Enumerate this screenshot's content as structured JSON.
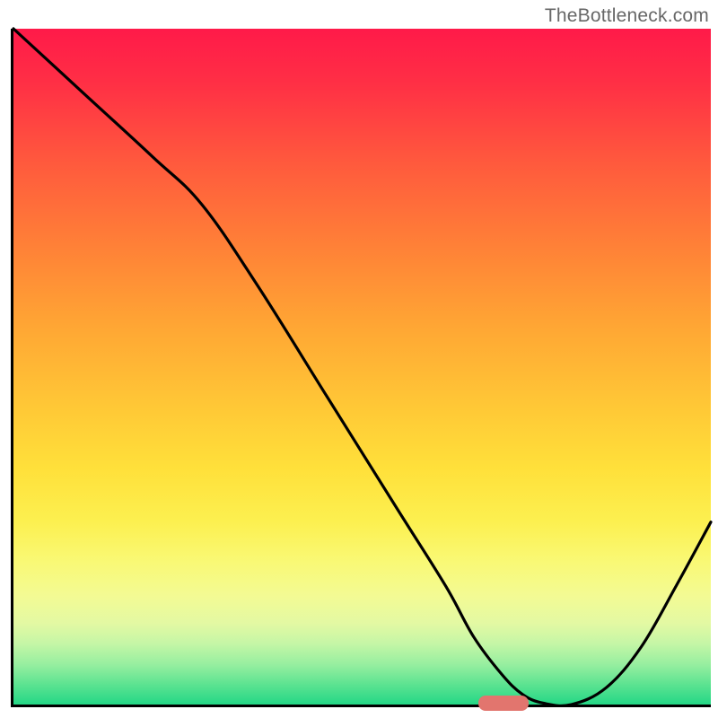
{
  "watermark": "TheBottleneck.com",
  "chart_data": {
    "type": "line",
    "title": "",
    "xlabel": "",
    "ylabel": "",
    "xlim": [
      0,
      100
    ],
    "ylim": [
      0,
      100
    ],
    "x": [
      0,
      10,
      20,
      27,
      35,
      45,
      55,
      62,
      66,
      70,
      73,
      76,
      80,
      85,
      90,
      95,
      100
    ],
    "values": [
      100,
      90.5,
      81,
      74,
      62,
      45.5,
      29,
      17.5,
      10,
      4.5,
      1.5,
      0.2,
      0,
      2.5,
      8.5,
      17.5,
      27
    ],
    "optimal_marker_x": 70,
    "colors": {
      "top": "#ff1a49",
      "mid": "#ffe03a",
      "bottom": "#24d786",
      "marker": "#e2756e"
    }
  }
}
